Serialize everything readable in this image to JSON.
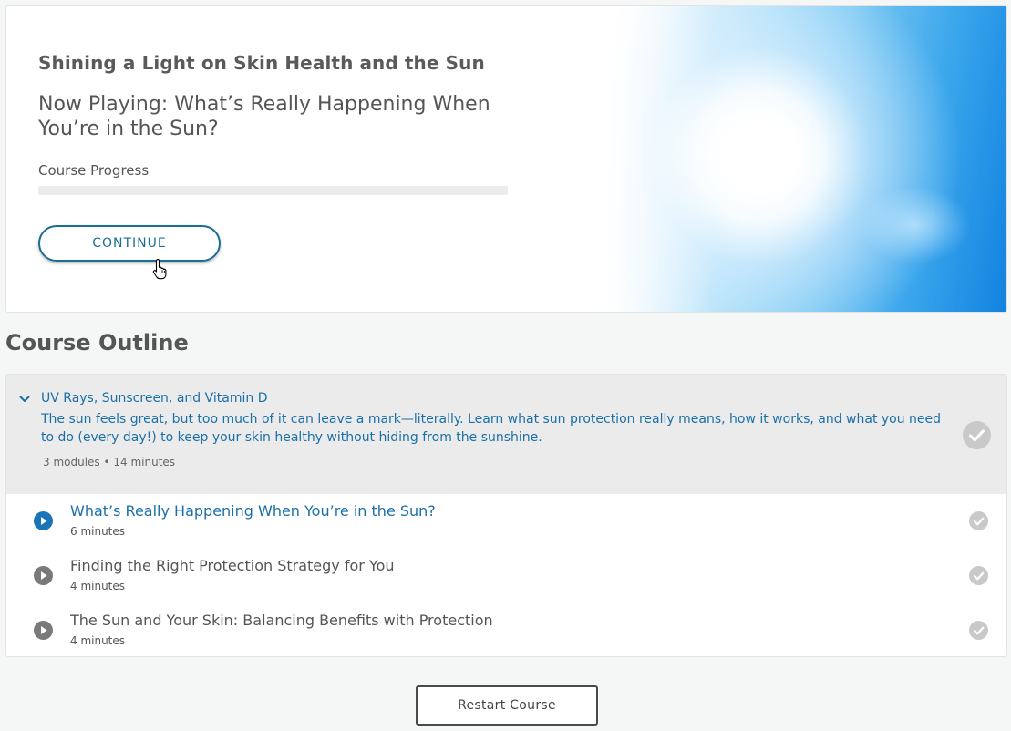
{
  "hero": {
    "course_title": "Shining a Light on Skin Health and the Sun",
    "now_playing": "Now Playing: What’s Really Happening When You’re in the Sun?",
    "progress_label": "Course Progress",
    "progress_fraction": 0,
    "continue_label": "CONTINUE",
    "image_description_icon": "sun-sky-image"
  },
  "outline": {
    "heading": "Course Outline",
    "section": {
      "title": "UV Rays, Sunscreen, and Vitamin D",
      "description": "The sun feels great, but too much of it can leave a mark—literally. Learn what sun protection really means, how it works, and what you need to do (every day!) to keep your skin healthy without hiding from the sunshine.",
      "meta": "3 modules • 14 minutes"
    },
    "modules": [
      {
        "title": "What’s Really Happening When You’re in the Sun?",
        "duration": "6 minutes",
        "active": true
      },
      {
        "title": "Finding the Right Protection Strategy for You",
        "duration": "4 minutes",
        "active": false
      },
      {
        "title": "The Sun and Your Skin: Balancing Benefits with Protection",
        "duration": "4 minutes",
        "active": false
      }
    ]
  },
  "footer": {
    "restart_label": "Restart Course"
  },
  "colors": {
    "accent_blue": "#1a6fa9",
    "button_teal": "#1a6f94",
    "play_active": "#1a75b8",
    "play_inactive": "#7a7a7a",
    "check_gray": "#c8c8c8"
  }
}
